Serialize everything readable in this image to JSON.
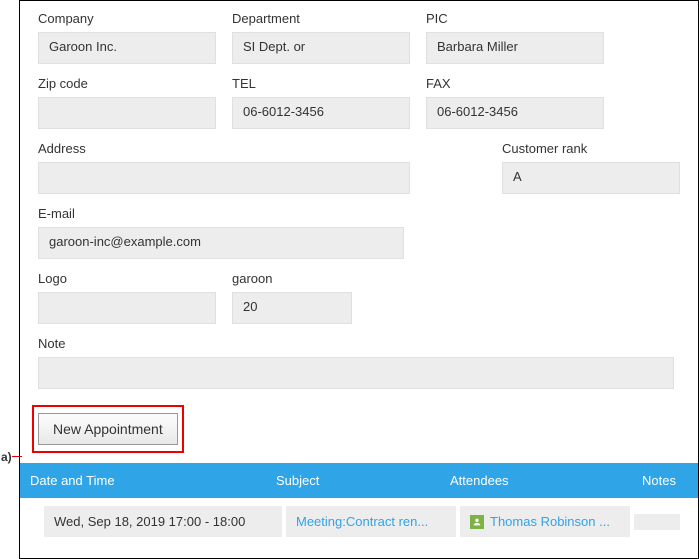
{
  "callout": "a)",
  "fields": {
    "company": {
      "label": "Company",
      "value": "Garoon Inc."
    },
    "department": {
      "label": "Department",
      "value": "SI Dept. or"
    },
    "pic": {
      "label": "PIC",
      "value": "Barbara Miller"
    },
    "zip": {
      "label": "Zip code",
      "value": ""
    },
    "tel": {
      "label": "TEL",
      "value": "06-6012-3456"
    },
    "fax": {
      "label": "FAX",
      "value": "06-6012-3456"
    },
    "address": {
      "label": "Address",
      "value": ""
    },
    "rank": {
      "label": "Customer rank",
      "value": "A"
    },
    "email": {
      "label": "E-mail",
      "value": "garoon-inc@example.com"
    },
    "logo": {
      "label": "Logo",
      "value": ""
    },
    "garoon": {
      "label": "garoon",
      "value": "20"
    },
    "note": {
      "label": "Note",
      "value": ""
    }
  },
  "button": {
    "new_appointment": "New Appointment"
  },
  "table": {
    "headers": {
      "datetime": "Date and Time",
      "subject": "Subject",
      "attendees": "Attendees",
      "notes": "Notes"
    },
    "rows": [
      {
        "datetime": "Wed, Sep 18, 2019 17:00 - 18:00",
        "subject": "Meeting:Contract ren...",
        "attendees": "Thomas Robinson ..."
      }
    ]
  }
}
